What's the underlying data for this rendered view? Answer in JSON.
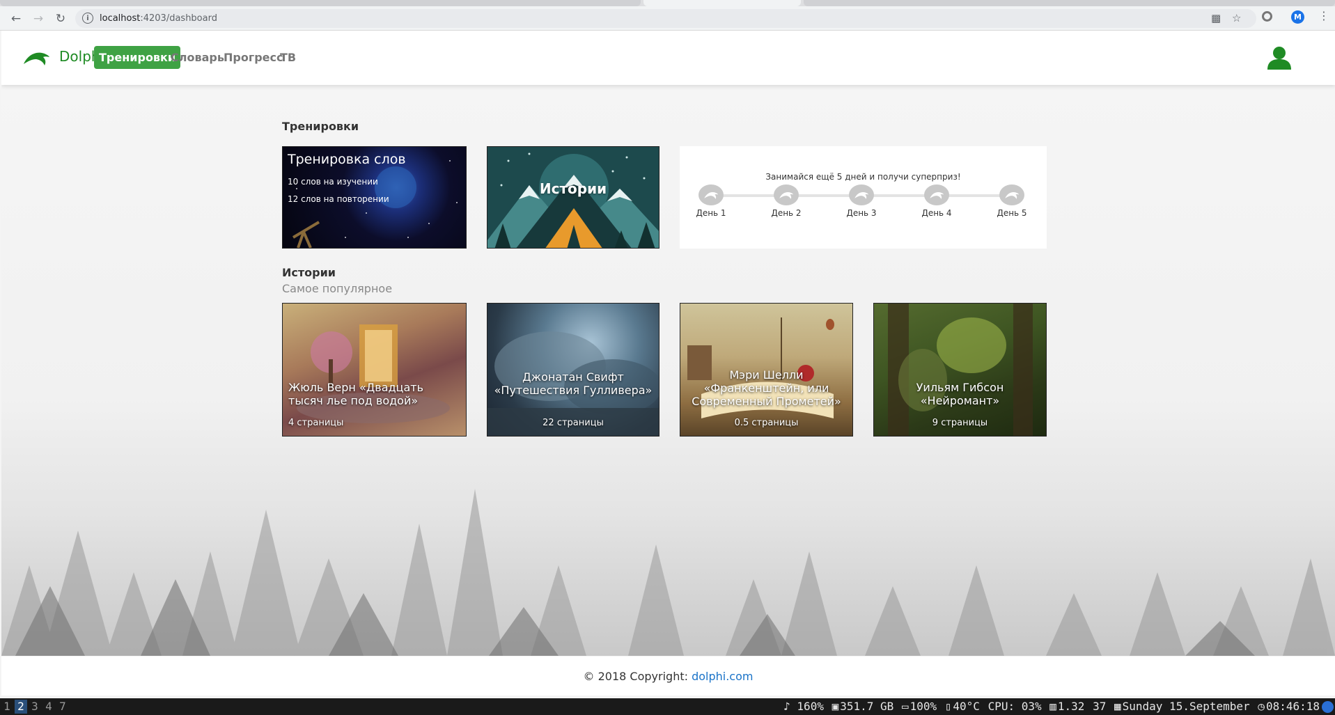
{
  "browser": {
    "url_host": "localhost",
    "url_path": ":4203/dashboard",
    "profile_initial": "M"
  },
  "header": {
    "brand": "Dolphi",
    "nav": [
      {
        "label": "Тренировки",
        "active": true
      },
      {
        "label": "Словарь",
        "active": false
      },
      {
        "label": "Прогресс",
        "active": false
      },
      {
        "label": "ТВ",
        "active": false
      }
    ]
  },
  "trainings": {
    "title": "Тренировки",
    "word_card": {
      "title": "Тренировка слов",
      "learning": "10 слов на изучении",
      "review": "12 слов на повторении"
    },
    "stories_card": {
      "label": "Истории"
    },
    "promo": {
      "text": "Занимайся ещё 5 дней и получи суперприз!",
      "days": [
        "День 1",
        "День 2",
        "День 3",
        "День 4",
        "День 5"
      ]
    }
  },
  "stories": {
    "title": "Истории",
    "subtitle": "Самое популярное",
    "items": [
      {
        "title": "Жюль Верн «Двадцать тысяч лье под водой»",
        "pages": "4 страницы"
      },
      {
        "title": "Джонатан Свифт «Путешествия Гулливера»",
        "pages": "22 страницы"
      },
      {
        "title": "Мэри Шелли «Франкенштейн, или Современный Прометей»",
        "pages": "0.5 страницы"
      },
      {
        "title": "Уильям Гибсон «Нейромант»",
        "pages": "9 страницы"
      }
    ]
  },
  "footer": {
    "copyright": "© 2018 Copyright: ",
    "link": "dolphi.com"
  },
  "taskbar": {
    "workspaces": [
      "1",
      "2",
      "3",
      "4",
      "7"
    ],
    "active_workspace": "2",
    "volume": "♪ 160%",
    "disk": "351.7 GB",
    "battery": "100%",
    "temp": "40°C",
    "cpu": "CPU: 03%",
    "load": "1.32",
    "mem": "37",
    "date": "Sunday 15.September",
    "time": "08:46:18"
  },
  "colors": {
    "brand_green": "#1f8b24",
    "nav_active_bg": "#3fa244",
    "link_blue": "#1a73c8"
  }
}
